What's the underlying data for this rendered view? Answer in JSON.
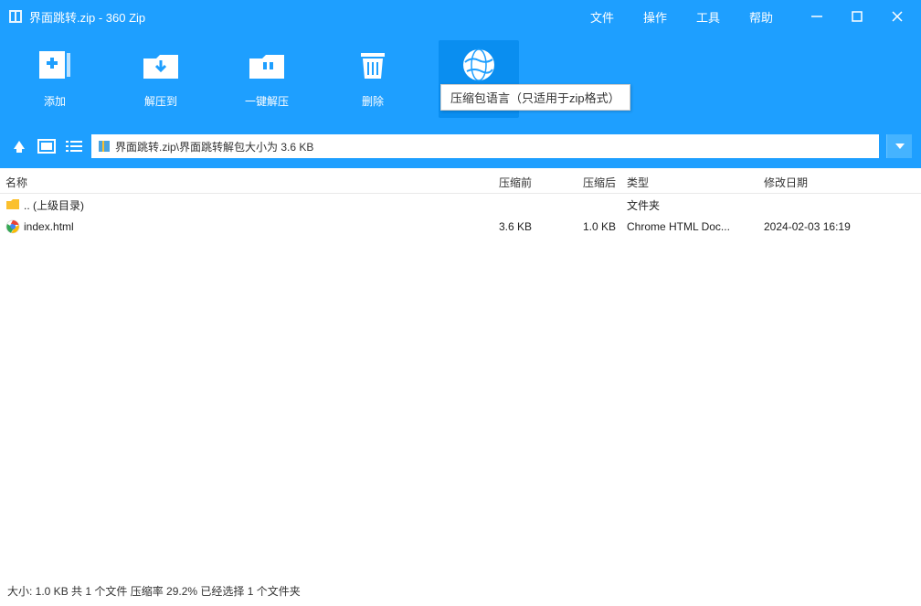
{
  "window": {
    "title": "界面跳转.zip - 360 Zip"
  },
  "menu": {
    "file": "文件",
    "operate": "操作",
    "tool": "工具",
    "help": "帮助"
  },
  "toolbar": {
    "add": "添加",
    "extract_to": "解压到",
    "one_click": "一键解压",
    "delete": "删除",
    "language": "压缩包语言"
  },
  "tooltip": {
    "language": "压缩包语言（只适用于zip格式）"
  },
  "path": {
    "text": "界面跳转.zip\\界面跳转解包大小为 3.6 KB"
  },
  "columns": {
    "name": "名称",
    "before": "压缩前",
    "after": "压缩后",
    "type": "类型",
    "date": "修改日期"
  },
  "rows": {
    "parent": {
      "name": ".. (上级目录)",
      "type": "文件夹"
    },
    "r0": {
      "name": "index.html",
      "before": "3.6 KB",
      "after": "1.0 KB",
      "type": "Chrome HTML Doc...",
      "date": "2024-02-03 16:19"
    }
  },
  "status": {
    "text": "大小: 1.0 KB 共 1 个文件 压缩率 29.2% 已经选择 1 个文件夹"
  }
}
